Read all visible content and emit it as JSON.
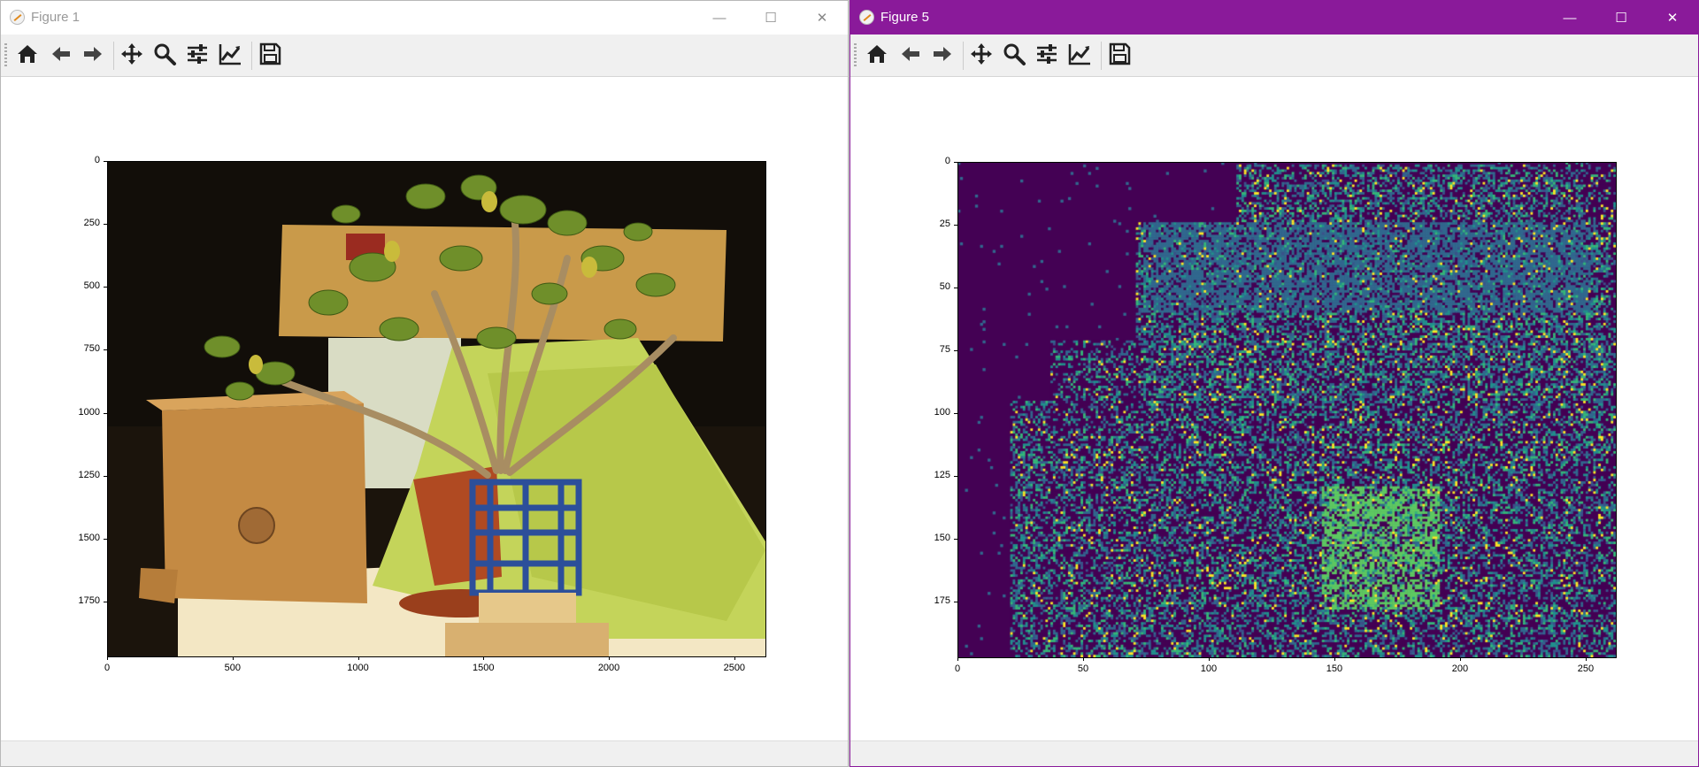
{
  "windows": [
    {
      "title": "Figure 1"
    },
    {
      "title": "Figure 5"
    }
  ],
  "toolbar": {
    "buttons": [
      "home-icon",
      "back-arrow-icon",
      "forward-arrow-icon",
      "pan-move-icon",
      "zoom-icon",
      "configure-subplots-icon",
      "edit-axis-icon",
      "save-icon"
    ]
  },
  "window_controls": {
    "minimize": "—",
    "maximize": "☐",
    "close": "✕"
  },
  "figure1": {
    "yticks": [
      "0",
      "250",
      "500",
      "750",
      "1000",
      "1250",
      "1500",
      "1750"
    ],
    "xticks": [
      "0",
      "500",
      "1000",
      "1500",
      "2000",
      "2500"
    ]
  },
  "figure5": {
    "yticks": [
      "0",
      "25",
      "50",
      "75",
      "100",
      "125",
      "150",
      "175"
    ],
    "xticks": [
      "0",
      "50",
      "100",
      "150",
      "200",
      "250"
    ]
  },
  "colors": {
    "accent_title_active": "#8a1a9a",
    "viridis_bg": "#440154"
  }
}
